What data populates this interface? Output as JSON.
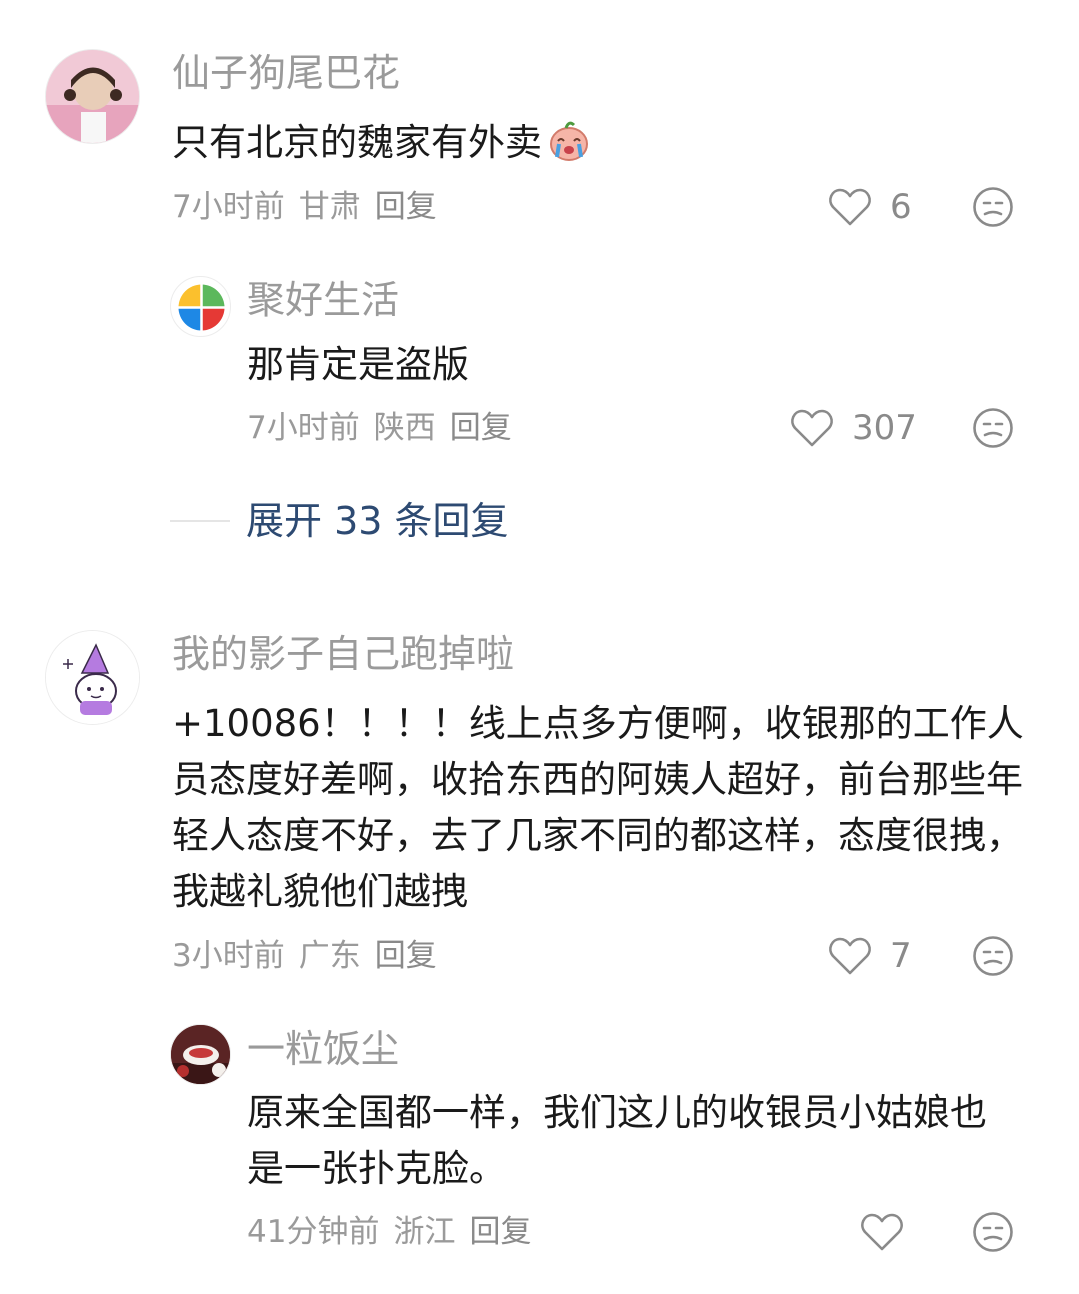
{
  "comments": [
    {
      "username": "仙子狗尾巴花",
      "text": "只有北京的魏家有外卖",
      "time": "7小时前",
      "location": "甘肃",
      "reply_label": "回复",
      "likes": "6",
      "replies": [
        {
          "username": "聚好生活",
          "text": "那肯定是盗版",
          "time": "7小时前",
          "location": "陕西",
          "reply_label": "回复",
          "likes": "307"
        }
      ],
      "expand_label": "展开 33 条回复"
    },
    {
      "username": "我的影子自己跑掉啦",
      "text": "+10086！！！！线上点多方便啊，收银那的工作人员态度好差啊，收拾东西的阿姨人超好，前台那些年轻人态度不好，去了几家不同的都这样，态度很拽，我越礼貌他们越拽",
      "time": "3小时前",
      "location": "广东",
      "reply_label": "回复",
      "likes": "7",
      "replies": [
        {
          "username": "一粒饭尘",
          "text": "原来全国都一样，我们这儿的收银员小姑娘也是一张扑克脸。",
          "time": "41分钟前",
          "location": "浙江",
          "reply_label": "回复",
          "likes": ""
        }
      ]
    }
  ],
  "icons": {
    "like": "heart-outline-icon",
    "dislike": "unhappy-face-icon",
    "emoji": "crying-emoji-icon"
  },
  "colors": {
    "meta": "#9a9a9a",
    "text": "#1a1a1a",
    "expand_link": "#2d4a72"
  }
}
